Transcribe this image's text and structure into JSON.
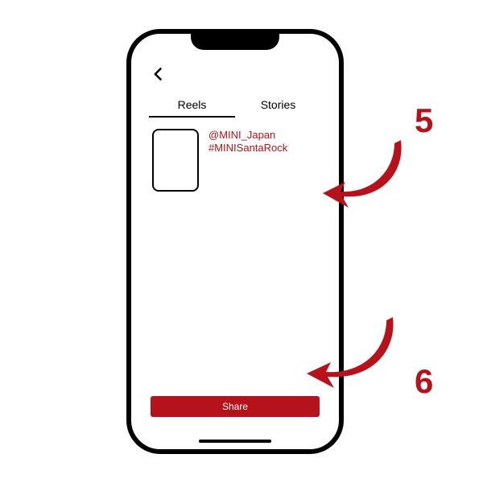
{
  "colors": {
    "accent": "#b5121b"
  },
  "nav": {
    "back_icon": "chevron-left"
  },
  "tabs": {
    "reels_label": "Reels",
    "stories_label": "Stories",
    "active": "reels"
  },
  "caption": {
    "mention": "@MINI_Japan",
    "hashtag": "#MINISantaRock"
  },
  "buttons": {
    "share_label": "Share"
  },
  "callouts": {
    "step5": "5",
    "step6": "6"
  }
}
